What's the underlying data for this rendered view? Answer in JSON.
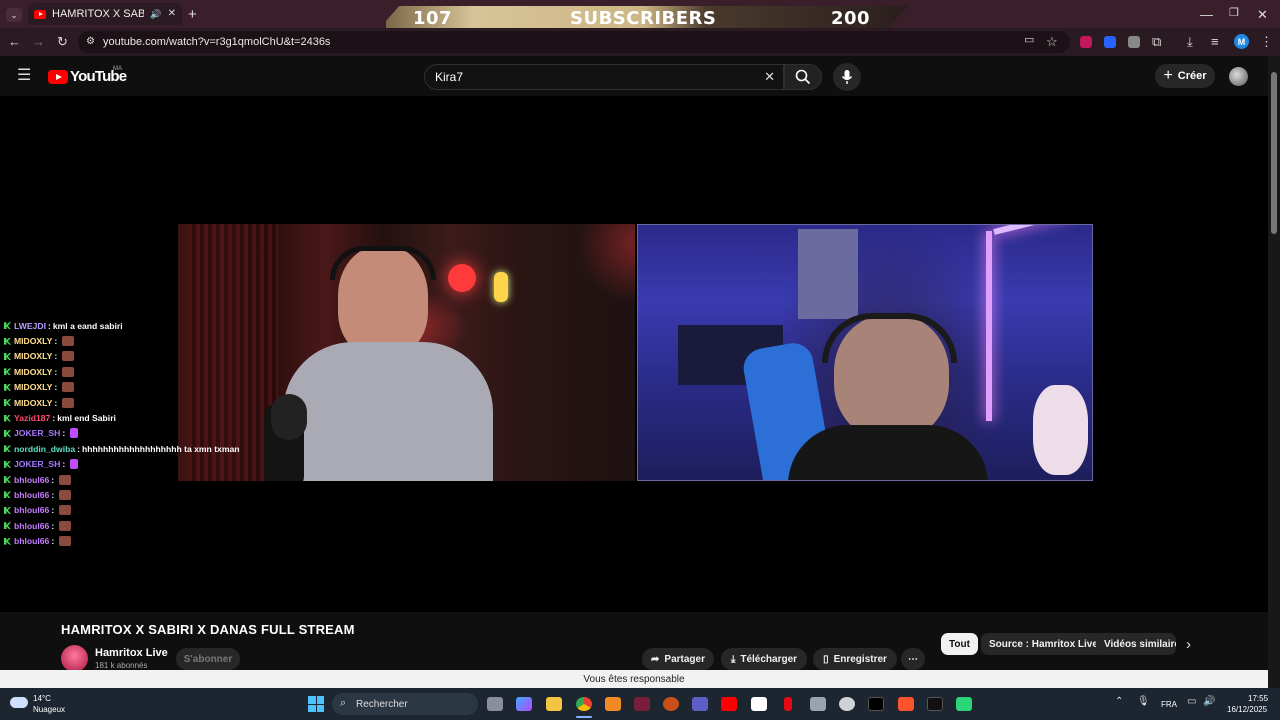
{
  "browser": {
    "tab_title": "HAMRITOX X SABIRI X DAN",
    "url": "youtube.com/watch?v=r3g1qmolChU&t=2436s",
    "profile_initial": "M",
    "window_controls": {
      "minimize": "—",
      "maximize": "❐",
      "close": "✕"
    }
  },
  "subscriber_overlay": {
    "current": "107",
    "label": "SUBSCRIBERS",
    "goal": "200"
  },
  "youtube": {
    "logo_text": "YouTube",
    "country_code": "MA",
    "search_query": "Kira7",
    "create_label": "Créer"
  },
  "chat": [
    {
      "user": "LWEJDI",
      "color": "#b79cff",
      "message": "kml a eand sabiri",
      "emote": false
    },
    {
      "user": "MIDOXLY",
      "color": "#ffe08a",
      "message": "",
      "emote": true
    },
    {
      "user": "MIDOXLY",
      "color": "#ffe08a",
      "message": "",
      "emote": true
    },
    {
      "user": "MIDOXLY",
      "color": "#ffe08a",
      "message": "",
      "emote": true
    },
    {
      "user": "MIDOXLY",
      "color": "#ffe08a",
      "message": "",
      "emote": true
    },
    {
      "user": "MIDOXLY",
      "color": "#ffe08a",
      "message": "",
      "emote": true
    },
    {
      "user": "Yazid187",
      "color": "#ff4a6e",
      "message": "kml end Sabiri",
      "emote": false
    },
    {
      "user": "JOKER_SH",
      "color": "#a875ff",
      "message": "",
      "emote": true
    },
    {
      "user": "norddin_dwiba",
      "color": "#5ee0c8",
      "message": "hhhhhhhhhhhhhhhhhhh ta xmn txman",
      "emote": false
    },
    {
      "user": "JOKER_SH",
      "color": "#a875ff",
      "message": "",
      "emote": true
    },
    {
      "user": "bhloul66",
      "color": "#c77dff",
      "message": "",
      "emote": true
    },
    {
      "user": "bhloul66",
      "color": "#c77dff",
      "message": "",
      "emote": true
    },
    {
      "user": "bhloul66",
      "color": "#c77dff",
      "message": "",
      "emote": true
    },
    {
      "user": "bhloul66",
      "color": "#c77dff",
      "message": "",
      "emote": true
    },
    {
      "user": "bhloul66",
      "color": "#c77dff",
      "message": "",
      "emote": true
    }
  ],
  "video": {
    "title": "HAMRITOX X SABIRI X DANAS FULL STREAM",
    "channel": "Hamritox Live",
    "subscribers": "181 k abonnés",
    "subscribe_label": "S'abonner",
    "actions": {
      "share": "Partager",
      "download": "Télécharger",
      "save": "Enregistrer"
    }
  },
  "chips": [
    "Tout",
    "Source : Hamritox Live",
    "Vidéos similaires"
  ],
  "notice": "Vous êtes responsable",
  "taskbar": {
    "temperature": "14°C",
    "weather": "Nuageux",
    "search_placeholder": "Rechercher",
    "language": "FRA",
    "time": "17:55",
    "date": "16/12/2025"
  }
}
